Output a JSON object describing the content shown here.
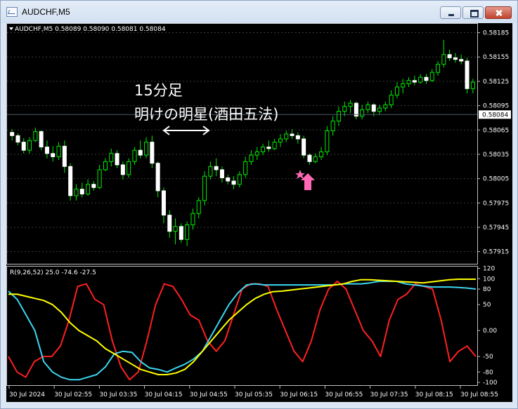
{
  "window": {
    "title": "AUDCHF,M5"
  },
  "chart_data": [
    {
      "type": "candlestick",
      "symbol_info": "AUDCHF,M5  0.58089 0.58090 0.58081 0.58084",
      "ylim": [
        0.579,
        0.58195
      ],
      "yticks": [
        "0.58185",
        "0.58155",
        "0.58125",
        "0.58095",
        "0.58065",
        "0.58035",
        "0.58005",
        "0.57975",
        "0.57945",
        "0.57915"
      ],
      "current_price": "0.58084",
      "annotation_line1": "15分足",
      "annotation_line2": "明けの明星(酒田五法)",
      "candles": [
        {
          "o": 0.58062,
          "h": 0.58066,
          "l": 0.58052,
          "c": 0.58058
        },
        {
          "o": 0.58058,
          "h": 0.58061,
          "l": 0.58046,
          "c": 0.5805
        },
        {
          "o": 0.5805,
          "h": 0.58055,
          "l": 0.58036,
          "c": 0.5804
        },
        {
          "o": 0.5804,
          "h": 0.58056,
          "l": 0.58036,
          "c": 0.58052
        },
        {
          "o": 0.58052,
          "h": 0.58068,
          "l": 0.5805,
          "c": 0.58063
        },
        {
          "o": 0.58063,
          "h": 0.58065,
          "l": 0.5804,
          "c": 0.58044
        },
        {
          "o": 0.58044,
          "h": 0.58052,
          "l": 0.5803,
          "c": 0.58036
        },
        {
          "o": 0.58036,
          "h": 0.58045,
          "l": 0.58026,
          "c": 0.58032
        },
        {
          "o": 0.58032,
          "h": 0.5805,
          "l": 0.58028,
          "c": 0.58045
        },
        {
          "o": 0.58045,
          "h": 0.58052,
          "l": 0.58012,
          "c": 0.5802
        },
        {
          "o": 0.5802,
          "h": 0.58024,
          "l": 0.57978,
          "c": 0.57984
        },
        {
          "o": 0.57984,
          "h": 0.57998,
          "l": 0.57978,
          "c": 0.57992
        },
        {
          "o": 0.57992,
          "h": 0.58,
          "l": 0.57982,
          "c": 0.57986
        },
        {
          "o": 0.57986,
          "h": 0.58004,
          "l": 0.57984,
          "c": 0.57998
        },
        {
          "o": 0.57998,
          "h": 0.58002,
          "l": 0.5799,
          "c": 0.57994
        },
        {
          "o": 0.57994,
          "h": 0.58022,
          "l": 0.57992,
          "c": 0.58016
        },
        {
          "o": 0.58016,
          "h": 0.5803,
          "l": 0.58014,
          "c": 0.58026
        },
        {
          "o": 0.58026,
          "h": 0.58042,
          "l": 0.5802,
          "c": 0.58036
        },
        {
          "o": 0.58036,
          "h": 0.5804,
          "l": 0.58018,
          "c": 0.58022
        },
        {
          "o": 0.58022,
          "h": 0.58026,
          "l": 0.58004,
          "c": 0.5801
        },
        {
          "o": 0.5801,
          "h": 0.5803,
          "l": 0.58006,
          "c": 0.58026
        },
        {
          "o": 0.58026,
          "h": 0.58044,
          "l": 0.58022,
          "c": 0.5804
        },
        {
          "o": 0.5804,
          "h": 0.58052,
          "l": 0.5803,
          "c": 0.58034
        },
        {
          "o": 0.58034,
          "h": 0.58056,
          "l": 0.5803,
          "c": 0.5805
        },
        {
          "o": 0.5805,
          "h": 0.58058,
          "l": 0.58018,
          "c": 0.58024
        },
        {
          "o": 0.58024,
          "h": 0.58026,
          "l": 0.57982,
          "c": 0.5799
        },
        {
          "o": 0.5799,
          "h": 0.57994,
          "l": 0.5795,
          "c": 0.5796
        },
        {
          "o": 0.5796,
          "h": 0.57966,
          "l": 0.57932,
          "c": 0.5794
        },
        {
          "o": 0.5794,
          "h": 0.57956,
          "l": 0.57924,
          "c": 0.57946
        },
        {
          "o": 0.57946,
          "h": 0.5795,
          "l": 0.57926,
          "c": 0.5793
        },
        {
          "o": 0.5793,
          "h": 0.57952,
          "l": 0.57922,
          "c": 0.57948
        },
        {
          "o": 0.57948,
          "h": 0.57968,
          "l": 0.57942,
          "c": 0.57962
        },
        {
          "o": 0.57962,
          "h": 0.57982,
          "l": 0.57956,
          "c": 0.57978
        },
        {
          "o": 0.57978,
          "h": 0.58014,
          "l": 0.57972,
          "c": 0.58008
        },
        {
          "o": 0.58008,
          "h": 0.58026,
          "l": 0.58004,
          "c": 0.5802
        },
        {
          "o": 0.5802,
          "h": 0.5803,
          "l": 0.58008,
          "c": 0.58016
        },
        {
          "o": 0.58016,
          "h": 0.5802,
          "l": 0.58,
          "c": 0.58006
        },
        {
          "o": 0.58006,
          "h": 0.5801,
          "l": 0.57998,
          "c": 0.58002
        },
        {
          "o": 0.58002,
          "h": 0.58008,
          "l": 0.57992,
          "c": 0.57998
        },
        {
          "o": 0.57998,
          "h": 0.58014,
          "l": 0.57994,
          "c": 0.5801
        },
        {
          "o": 0.5801,
          "h": 0.58032,
          "l": 0.58006,
          "c": 0.58026
        },
        {
          "o": 0.58026,
          "h": 0.5804,
          "l": 0.58022,
          "c": 0.58034
        },
        {
          "o": 0.58034,
          "h": 0.58044,
          "l": 0.58028,
          "c": 0.58038
        },
        {
          "o": 0.58038,
          "h": 0.58048,
          "l": 0.58034,
          "c": 0.58044
        },
        {
          "o": 0.58044,
          "h": 0.58052,
          "l": 0.58038,
          "c": 0.58042
        },
        {
          "o": 0.58042,
          "h": 0.58054,
          "l": 0.5804,
          "c": 0.5805
        },
        {
          "o": 0.5805,
          "h": 0.5806,
          "l": 0.58044,
          "c": 0.58054
        },
        {
          "o": 0.58054,
          "h": 0.58064,
          "l": 0.5805,
          "c": 0.5806
        },
        {
          "o": 0.5806,
          "h": 0.58066,
          "l": 0.58054,
          "c": 0.58058
        },
        {
          "o": 0.58058,
          "h": 0.58062,
          "l": 0.58048,
          "c": 0.58054
        },
        {
          "o": 0.58054,
          "h": 0.58058,
          "l": 0.5803,
          "c": 0.58034
        },
        {
          "o": 0.58034,
          "h": 0.58036,
          "l": 0.58022,
          "c": 0.58026
        },
        {
          "o": 0.58026,
          "h": 0.58036,
          "l": 0.58024,
          "c": 0.58032
        },
        {
          "o": 0.58032,
          "h": 0.58044,
          "l": 0.58028,
          "c": 0.58038
        },
        {
          "o": 0.58038,
          "h": 0.5807,
          "l": 0.58034,
          "c": 0.58064
        },
        {
          "o": 0.58064,
          "h": 0.58082,
          "l": 0.58058,
          "c": 0.58076
        },
        {
          "o": 0.58076,
          "h": 0.58094,
          "l": 0.5807,
          "c": 0.58088
        },
        {
          "o": 0.58088,
          "h": 0.581,
          "l": 0.58082,
          "c": 0.58094
        },
        {
          "o": 0.58094,
          "h": 0.58102,
          "l": 0.58086,
          "c": 0.58098
        },
        {
          "o": 0.58098,
          "h": 0.581,
          "l": 0.58078,
          "c": 0.58082
        },
        {
          "o": 0.58082,
          "h": 0.58096,
          "l": 0.58078,
          "c": 0.5809
        },
        {
          "o": 0.5809,
          "h": 0.581,
          "l": 0.58086,
          "c": 0.58096
        },
        {
          "o": 0.58096,
          "h": 0.58098,
          "l": 0.58082,
          "c": 0.58088
        },
        {
          "o": 0.58088,
          "h": 0.58096,
          "l": 0.58084,
          "c": 0.58092
        },
        {
          "o": 0.58092,
          "h": 0.581,
          "l": 0.58088,
          "c": 0.58096
        },
        {
          "o": 0.58096,
          "h": 0.58114,
          "l": 0.58092,
          "c": 0.58108
        },
        {
          "o": 0.58108,
          "h": 0.58124,
          "l": 0.58104,
          "c": 0.58118
        },
        {
          "o": 0.58118,
          "h": 0.58128,
          "l": 0.5811,
          "c": 0.58122
        },
        {
          "o": 0.58122,
          "h": 0.5813,
          "l": 0.58118,
          "c": 0.58126
        },
        {
          "o": 0.58126,
          "h": 0.58132,
          "l": 0.5812,
          "c": 0.58124
        },
        {
          "o": 0.58124,
          "h": 0.58134,
          "l": 0.58122,
          "c": 0.5813
        },
        {
          "o": 0.5813,
          "h": 0.58134,
          "l": 0.58122,
          "c": 0.58126
        },
        {
          "o": 0.58126,
          "h": 0.5814,
          "l": 0.58124,
          "c": 0.58136
        },
        {
          "o": 0.58136,
          "h": 0.5815,
          "l": 0.58132,
          "c": 0.58146
        },
        {
          "o": 0.58146,
          "h": 0.58176,
          "l": 0.58142,
          "c": 0.58158
        },
        {
          "o": 0.58158,
          "h": 0.58164,
          "l": 0.5815,
          "c": 0.58154
        },
        {
          "o": 0.58154,
          "h": 0.5816,
          "l": 0.58148,
          "c": 0.58152
        },
        {
          "o": 0.58152,
          "h": 0.58158,
          "l": 0.58146,
          "c": 0.5815
        },
        {
          "o": 0.5815,
          "h": 0.58154,
          "l": 0.5811,
          "c": 0.58116
        },
        {
          "o": 0.58116,
          "h": 0.58128,
          "l": 0.5811,
          "c": 0.58124
        }
      ]
    },
    {
      "type": "line",
      "indicator_label": "R(9,26,52) 25.0 -74.6 -27.5",
      "ylim": [
        -104,
        122
      ],
      "yticks": [
        "120",
        "100",
        "80",
        "50",
        "0.00",
        "-50",
        "-80",
        "-100"
      ],
      "xticks": [
        "30 Jul 2024",
        "30 Jul 02:55",
        "30 Jul 03:35",
        "30 Jul 04:15",
        "30 Jul 04:55",
        "30 Jul 05:35",
        "30 Jul 06:15",
        "30 Jul 06:55",
        "30 Jul 07:35",
        "30 Jul 08:15",
        "30 Jul 08:55"
      ],
      "series": [
        {
          "color": "#ff2020",
          "values": [
            -50,
            -80,
            -90,
            -60,
            -50,
            -50,
            -30,
            20,
            85,
            90,
            60,
            50,
            -20,
            -70,
            -95,
            -80,
            -20,
            50,
            90,
            85,
            60,
            30,
            20,
            -20,
            -40,
            -20,
            30,
            80,
            90,
            90,
            85,
            40,
            0,
            -40,
            -60,
            -20,
            40,
            80,
            95,
            80,
            40,
            0,
            -20,
            -50,
            20,
            60,
            70,
            90,
            85,
            80,
            20,
            -60,
            -40,
            -30,
            -50
          ]
        },
        {
          "color": "#3ad6f0",
          "values": [
            76,
            60,
            30,
            0,
            -60,
            -80,
            -90,
            -95,
            -95,
            -90,
            -85,
            -70,
            -45,
            -40,
            -42,
            -60,
            -72,
            -75,
            -80,
            -72,
            -65,
            -55,
            -40,
            -10,
            20,
            50,
            72,
            88,
            90,
            88,
            88,
            88,
            88,
            88,
            88,
            88,
            88,
            88,
            90,
            90,
            90,
            92,
            95,
            95,
            95,
            90,
            88,
            86,
            84,
            84,
            84,
            83,
            82,
            80
          ]
        },
        {
          "color": "#ffff00",
          "values": [
            70,
            70,
            66,
            62,
            58,
            50,
            35,
            15,
            0,
            -10,
            -20,
            -35,
            -45,
            -55,
            -65,
            -75,
            -80,
            -85,
            -85,
            -82,
            -75,
            -60,
            -40,
            -20,
            0,
            20,
            35,
            50,
            62,
            70,
            75,
            76,
            78,
            80,
            82,
            84,
            86,
            88,
            90,
            95,
            98,
            98,
            97,
            96,
            95,
            94,
            93,
            92,
            94,
            96,
            98,
            99,
            99,
            99
          ]
        }
      ]
    }
  ]
}
